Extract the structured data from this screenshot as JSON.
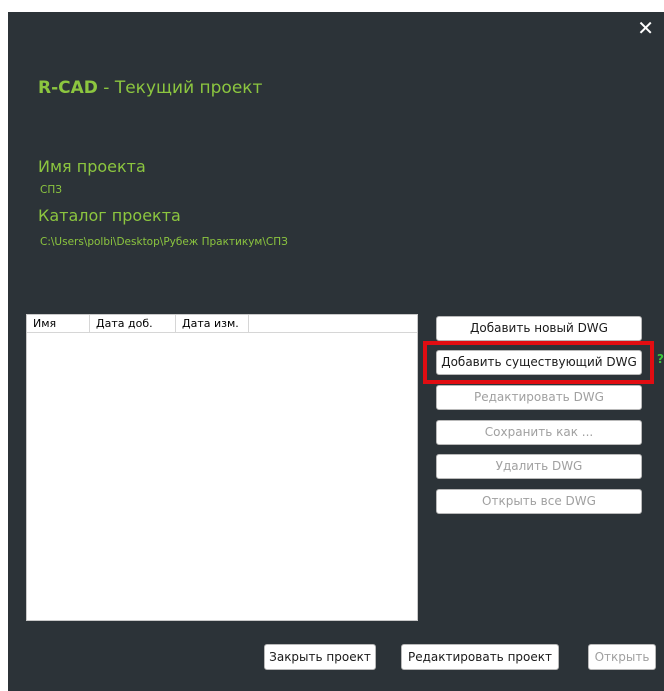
{
  "dialog": {
    "close_glyph": "✕",
    "title_brand": "R-CAD",
    "title_rest": " - Текущий проект"
  },
  "project": {
    "name_label": "Имя проекта",
    "name_value": "СПЗ",
    "catalog_label": "Каталог проекта",
    "catalog_value": "C:\\Users\\polbi\\Desktop\\Рубеж Практикум\\СПЗ"
  },
  "table": {
    "columns": [
      "Имя",
      "Дата доб.",
      "Дата изм."
    ],
    "rows": []
  },
  "side_buttons": {
    "add_new": "Добавить новый DWG",
    "add_existing": "Добавить существующий DWG",
    "edit": "Редактировать DWG",
    "save_as": "Сохранить как ...",
    "delete": "Удалить DWG",
    "open_all": "Открыть все DWG",
    "help_glyph": "?"
  },
  "bottom_buttons": {
    "close_project": "Закрыть проект",
    "edit_project": "Редактировать проект",
    "open": "Открыть"
  },
  "colors": {
    "background": "#2c3338",
    "accent": "#8cc63f",
    "highlight": "#e10d12",
    "help": "#3cc63c"
  }
}
